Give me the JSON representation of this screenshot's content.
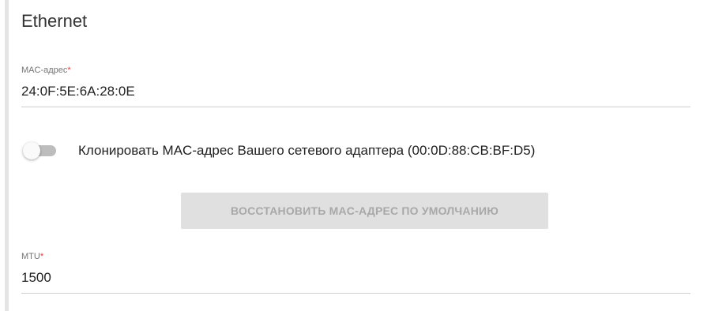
{
  "section": {
    "title": "Ethernet"
  },
  "mac_field": {
    "label": "MAC-адрес",
    "required_mark": "*",
    "value": "24:0F:5E:6A:28:0E"
  },
  "clone_toggle": {
    "label": "Клонировать MAC-адрес Вашего сетевого адаптера (00:0D:88:CB:BF:D5)",
    "enabled": false
  },
  "restore_button": {
    "label": "ВОССТАНОВИТЬ MAC-АДРЕС ПО УМОЛЧАНИЮ",
    "disabled": true
  },
  "mtu_field": {
    "label": "MTU",
    "required_mark": "*",
    "value": "1500"
  },
  "colors": {
    "required": "#e53935",
    "divider": "#cfcfcf",
    "button_disabled_bg": "#e0e0e0",
    "button_disabled_text": "#a8a8a8"
  }
}
